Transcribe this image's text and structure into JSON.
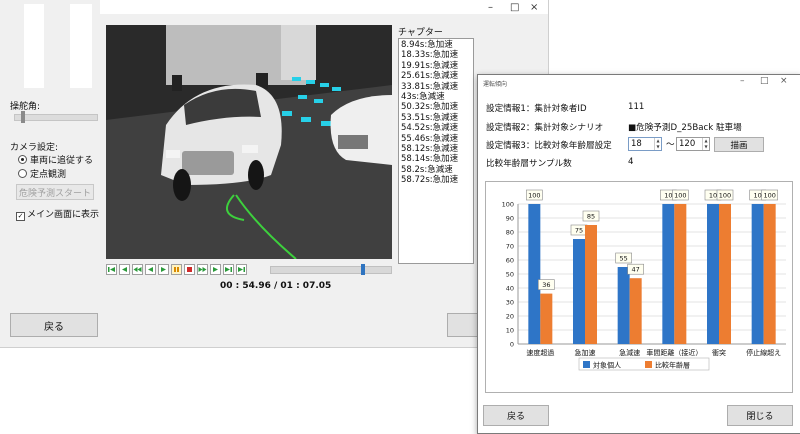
{
  "main_window": {
    "steering_label": "操舵角:",
    "camera_label": "カメラ設定:",
    "camera_options": [
      "車両に追従する",
      "定点観測"
    ],
    "camera_selected": 0,
    "danger_button": "危険予測スタート",
    "show_main_label": "メイン画面に表示",
    "show_main_checked": true,
    "back_button": "戻る",
    "window_controls": [
      "–",
      "□",
      "×"
    ]
  },
  "chapters": {
    "title": "チャプター",
    "items": [
      "8.94s:急加速",
      "18.33s:急加速",
      "19.91s:急減速",
      "25.61s:急減速",
      "33.81s:急減速",
      "43s:急減速",
      "50.32s:急加速",
      "53.51s:急減速",
      "54.52s:急減速",
      "55.46s:急減速",
      "58.12s:急減速",
      "58.14s:急加速",
      "58.2s:急減速",
      "58.72s:急加速"
    ]
  },
  "playback": {
    "time": "00 : 54.96 / 01 : 07.05",
    "position": 0.78,
    "buttons": [
      "skip-start",
      "step-back",
      "rewind",
      "back",
      "play",
      "pause",
      "stop",
      "forward",
      "fast-forward",
      "step-forward",
      "skip-end"
    ]
  },
  "dialog": {
    "window_title": "運転傾向",
    "info1_label": "設定情報1：集計対象者ID",
    "info1_value": "111",
    "info2_label": "設定情報2：集計対象シナリオ",
    "info2_value": "■危険予測D_25Back 駐車場",
    "info3_label": "設定情報3：比較対象年齢層設定",
    "age_from": "18",
    "age_tilde": "〜",
    "age_to": "120",
    "draw_button": "描画",
    "sample_label": "比較年齢層サンプル数",
    "sample_value": "4",
    "back_button": "戻る",
    "close_button": "閉じる",
    "window_controls": [
      "–",
      "□",
      "×"
    ]
  },
  "colors": {
    "series_blue": "#2e75c7",
    "series_orange": "#ed7d31"
  },
  "chart_data": {
    "type": "bar",
    "categories": [
      "速度超過",
      "急加速",
      "急減速",
      "車間距離（接近）",
      "衝突",
      "停止線超え"
    ],
    "series": [
      {
        "name": "対象個人",
        "values": [
          100,
          75,
          55,
          100,
          100,
          100
        ]
      },
      {
        "name": "比較年齢層",
        "values": [
          36,
          85,
          47,
          100,
          100,
          100
        ]
      }
    ],
    "data_labels": [
      [
        "100",
        "36"
      ],
      [
        "75",
        "85"
      ],
      [
        "55",
        "47"
      ],
      [
        "10",
        "100"
      ],
      [
        "10",
        "100"
      ],
      [
        "10",
        "100"
      ]
    ],
    "ylim": [
      0,
      100
    ],
    "yticks": [
      0,
      10,
      20,
      30,
      40,
      50,
      60,
      70,
      80,
      90,
      100
    ],
    "grid": true,
    "legend": "bottom"
  }
}
